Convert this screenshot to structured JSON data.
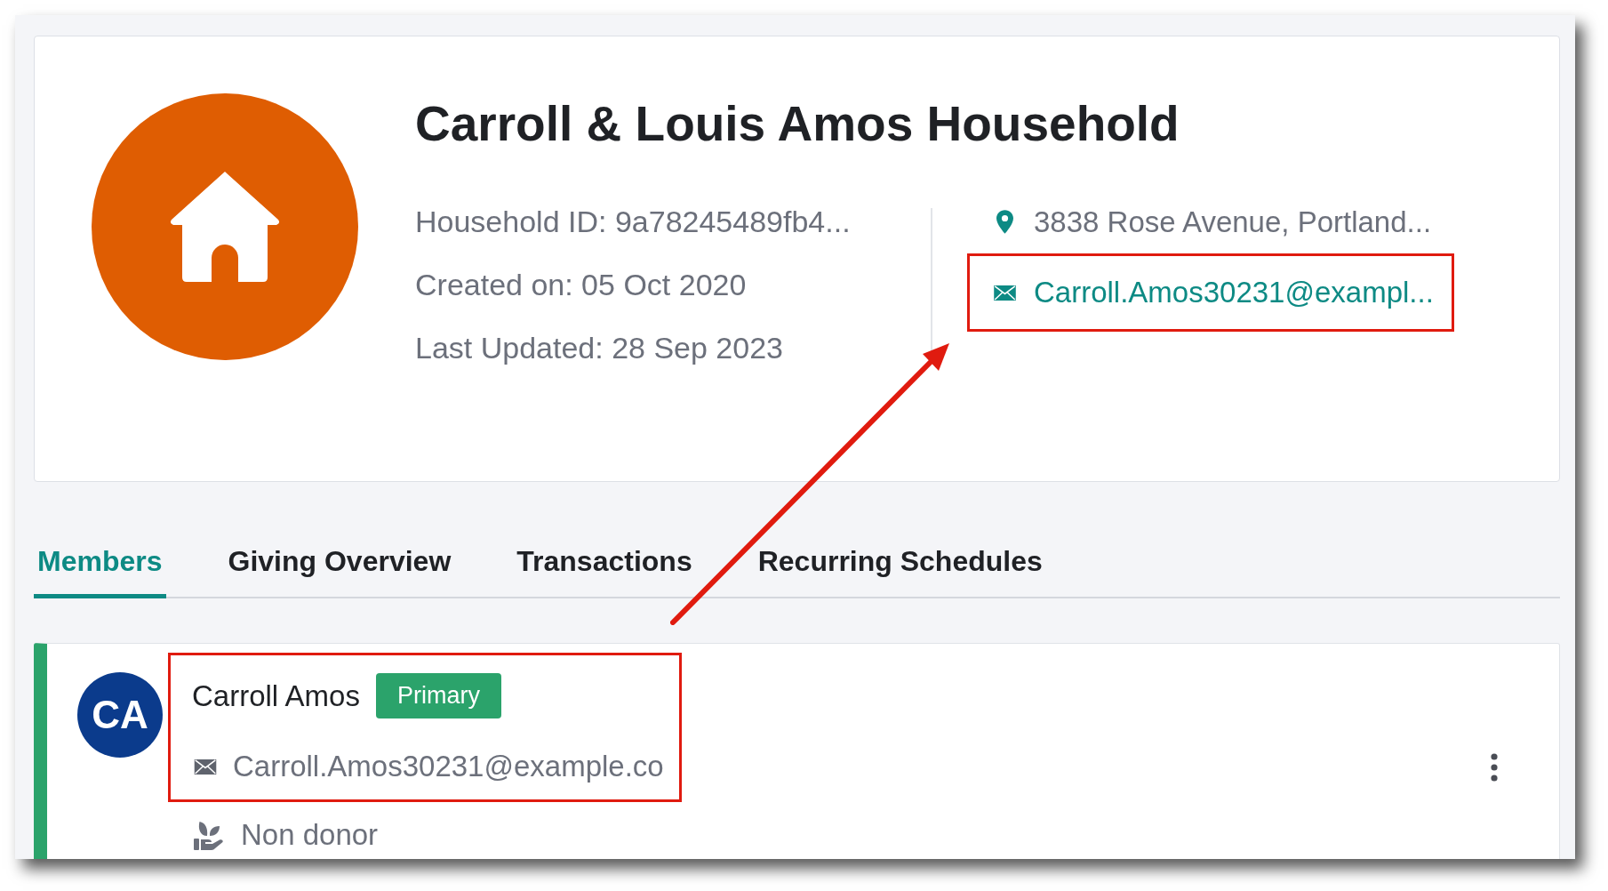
{
  "household": {
    "title": "Carroll & Louis Amos Household",
    "details": [
      "Household ID: 9a78245489fb4...",
      "Created on: 05 Oct 2020",
      "Last Updated: 28 Sep 2023"
    ],
    "contact": [
      {
        "kind": "address",
        "text": "3838 Rose Avenue, Portland...",
        "highlighted": false
      },
      {
        "kind": "email",
        "text": "Carroll.Amos30231@exampl...",
        "highlighted": true
      }
    ]
  },
  "tabs": [
    {
      "label": "Members",
      "selected": true
    },
    {
      "label": "Giving Overview",
      "selected": false
    },
    {
      "label": "Transactions",
      "selected": false
    },
    {
      "label": "Recurring Schedules",
      "selected": false
    }
  ],
  "members": [
    {
      "initials": "CA",
      "name": "Carroll Amos",
      "badge": "Primary",
      "email": "Carroll.Amos30231@example.co",
      "donor_status": "Non donor",
      "highlighted": true
    }
  ]
}
